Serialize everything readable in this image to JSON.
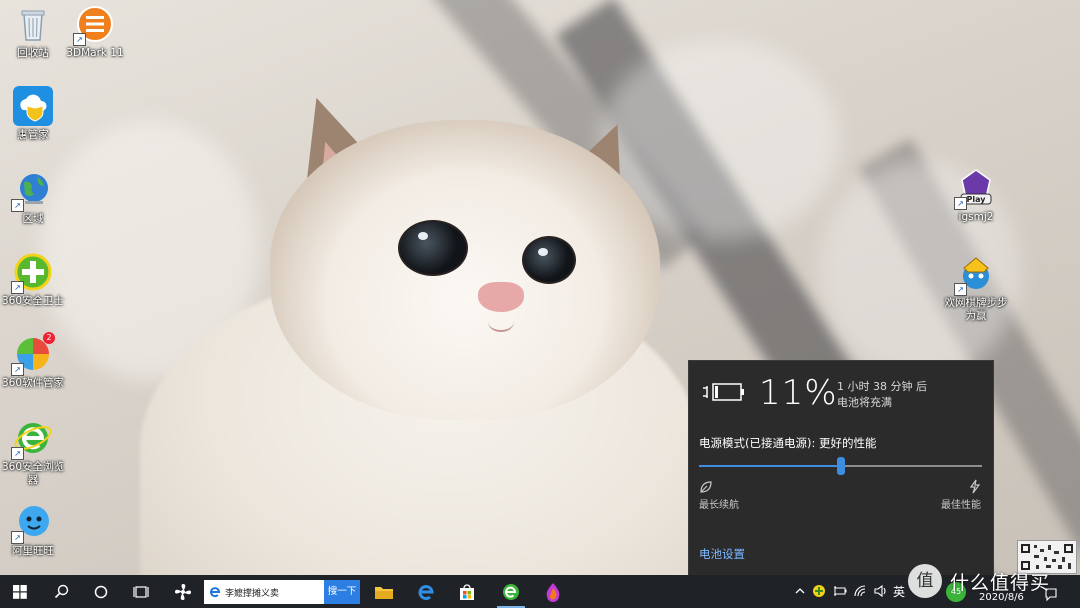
{
  "desktop": {
    "icons": [
      {
        "label": "回收站"
      },
      {
        "label": "3DMark 11"
      },
      {
        "label": "惠管家"
      },
      {
        "label": "区域"
      },
      {
        "label": "360安全卫士"
      },
      {
        "label": "360软件管家",
        "badge": "2"
      },
      {
        "label": "360安全浏览器"
      },
      {
        "label": "阿里旺旺"
      },
      {
        "label": "igsmj2"
      },
      {
        "label": "欢网棋牌步步为赢"
      }
    ]
  },
  "battery_flyout": {
    "percent": "11%",
    "time_line1": "1 小时 38 分钟 后",
    "time_line2": "电池将充满",
    "mode_label": "电源模式(已接通电源): 更好的性能",
    "slider_level": 0.5,
    "left_label": "最长续航",
    "right_label": "最佳性能",
    "settings_link": "电池设置"
  },
  "taskbar": {
    "search_text": "李嬷撑摊义卖",
    "search_button": "搜一下",
    "ime": "英",
    "tray_badge": "45",
    "date": "2020/8/6"
  },
  "watermark": {
    "text": "什么值得买",
    "glyph": "值"
  },
  "colors": {
    "accent": "#3d8ee0",
    "flyout_bg": "#2b2b2b",
    "taskbar_bg": "#1f2227",
    "link": "#7db8ff"
  }
}
